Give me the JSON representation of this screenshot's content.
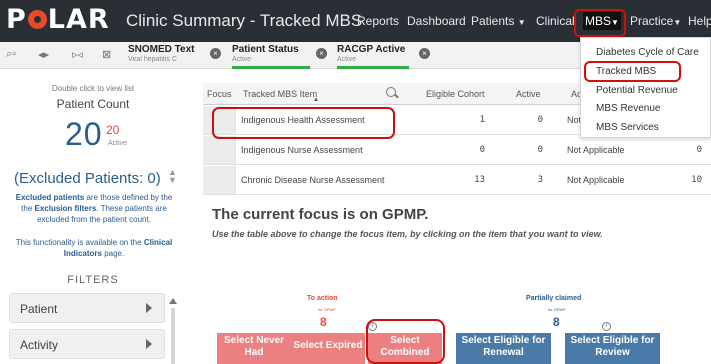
{
  "app": {
    "logo": "POLAR",
    "title": "Clinic Summary - Tracked MBS"
  },
  "nav": {
    "reports": "Reports",
    "dashboard": "Dashboard",
    "patients": "Patients",
    "clinical": "Clinical",
    "mbs": "MBS",
    "practice": "Practice",
    "help": "Help"
  },
  "filters_bar": {
    "chips": [
      {
        "title": "SNOMED Text",
        "sub": "Viral hepatitis C"
      },
      {
        "title": "Patient Status",
        "sub": "Active"
      },
      {
        "title": "RACGP Active",
        "sub": "Active"
      }
    ]
  },
  "left_panel": {
    "hint": "Double click to view list",
    "count_title": "Patient Count",
    "count_big": "20",
    "count_small": "20",
    "count_active": "Active",
    "excluded": "(Excluded Patients: 0)",
    "para_1a": "Excluded patients",
    "para_1b": " are those defined by the the ",
    "para_1c": "Exclusion filters",
    "para_1d": ". These patients are excluded from the patient count.",
    "para_2a": "This functionality is available on the ",
    "para_2b": "Clinical Indicators",
    "para_2c": " page.",
    "filters_label": "FILTERS",
    "filter_items": [
      "Patient",
      "Activity"
    ]
  },
  "table": {
    "headers": {
      "focus": "Focus",
      "item": "Tracked MBS Item",
      "cohort": "Eligible Cohort",
      "active": "Active",
      "act": "Act"
    },
    "rows": [
      {
        "item": "Indigenous Health Assessment",
        "cohort": "1",
        "active": "0",
        "status": "Not",
        "last": ""
      },
      {
        "item": "Indigenous Nurse Assessment",
        "cohort": "0",
        "active": "0",
        "status": "Not Applicable",
        "last": "0"
      },
      {
        "item": "Chronic Disease Nurse Assessment",
        "cohort": "13",
        "active": "3",
        "status": "Not Applicable",
        "last": "10"
      }
    ]
  },
  "mbs_menu": {
    "items": [
      "Diabetes Cycle of Care",
      "Tracked MBS",
      "Potential Revenue",
      "MBS Revenue",
      "MBS Services"
    ]
  },
  "focus": {
    "title": "The current focus is on GPMP.",
    "subtitle": "Use the table above to change the focus item, by clicking on the item that you want to view.",
    "to_action_label": "To action",
    "to_action_sub": "for GPMP",
    "to_action_value": "8",
    "partial_label": "Partially claimed",
    "partial_sub": "for GPMP",
    "partial_value": "8",
    "buttons": {
      "never_had": "Select Never Had",
      "expired": "Select Expired",
      "combined": "Select Combined",
      "renewal": "Select Eligible for Renewal",
      "review": "Select Eligible for Review"
    }
  },
  "colors": {
    "nav_bg": "#2a2f36",
    "accent_red": "#cc1111",
    "brand_orange": "#e84a27",
    "link_blue": "#2b5d8e",
    "action_red": "#ec8080",
    "action_blue": "#4a7aa8"
  }
}
